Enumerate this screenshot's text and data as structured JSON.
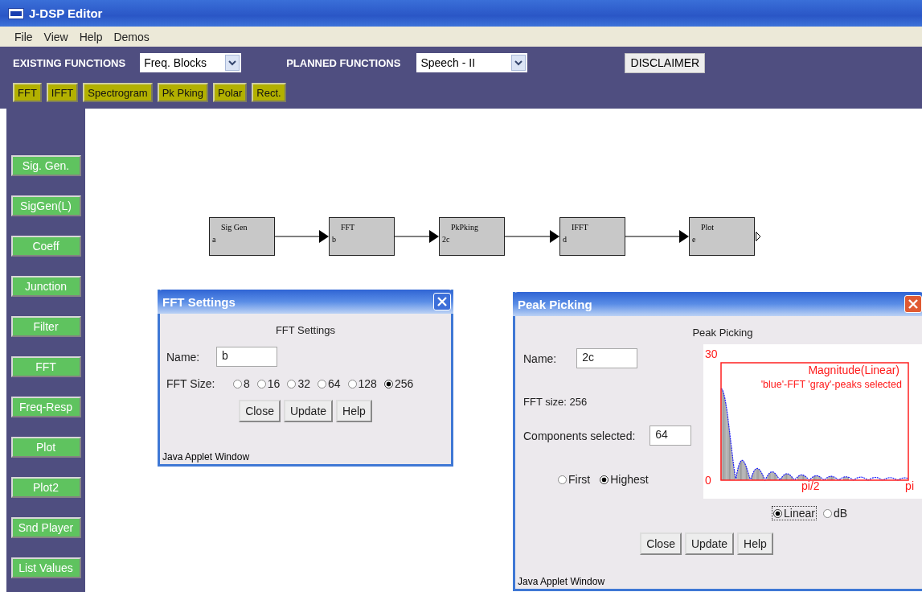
{
  "window": {
    "title": "J-DSP Editor"
  },
  "menu": [
    "File",
    "View",
    "Help",
    "Demos"
  ],
  "toolbar": {
    "existing_label": "EXISTING FUNCTIONS",
    "existing_select": "Freq. Blocks",
    "planned_label": "PLANNED FUNCTIONS",
    "planned_select": "Speech - II",
    "disclaimer": "DISCLAIMER"
  },
  "function_blocks": [
    "FFT",
    "IFFT",
    "Spectrogram",
    "Pk Pking",
    "Polar",
    "Rect."
  ],
  "sidebar": [
    "Sig. Gen.",
    "SigGen(L)",
    "Coeff",
    "Junction",
    "Filter",
    "FFT",
    "Freq-Resp",
    "Plot",
    "Plot2",
    "Snd Player",
    "List Values"
  ],
  "diagram": {
    "nodes": [
      {
        "title": "Sig Gen",
        "name": "a"
      },
      {
        "title": "FFT",
        "name": "b"
      },
      {
        "title": "PkPking",
        "name": "2c"
      },
      {
        "title": "IFFT",
        "name": "d"
      },
      {
        "title": "Plot",
        "name": "e"
      }
    ]
  },
  "fft_dialog": {
    "title": "FFT Settings",
    "heading": "FFT Settings",
    "name_label": "Name:",
    "name_value": "b",
    "size_label": "FFT Size:",
    "sizes": [
      {
        "label": "8",
        "selected": false
      },
      {
        "label": "16",
        "selected": false
      },
      {
        "label": "32",
        "selected": false
      },
      {
        "label": "64",
        "selected": false
      },
      {
        "label": "128",
        "selected": false
      },
      {
        "label": "256",
        "selected": true
      }
    ],
    "buttons": [
      "Close",
      "Update",
      "Help"
    ],
    "footer": "Java Applet Window"
  },
  "peak_dialog": {
    "title": "Peak Picking",
    "heading": "Peak Picking",
    "name_label": "Name:",
    "name_value": "2c",
    "fft_size": "FFT size: 256",
    "components_label": "Components selected:",
    "components_value": "64",
    "modes": [
      {
        "label": "First",
        "selected": false
      },
      {
        "label": "Highest",
        "selected": true
      }
    ],
    "plot": {
      "y_max": "30",
      "y_min": "0",
      "x_mid": "pi/2",
      "x_max": "pi",
      "title": "Magnitude(Linear)",
      "legend": "'blue'-FFT  'gray'-peaks selected"
    },
    "scales": [
      {
        "label": "Linear",
        "selected": true
      },
      {
        "label": "dB",
        "selected": false
      }
    ],
    "buttons": [
      "Close",
      "Update",
      "Help"
    ],
    "footer": "Java Applet Window"
  }
}
